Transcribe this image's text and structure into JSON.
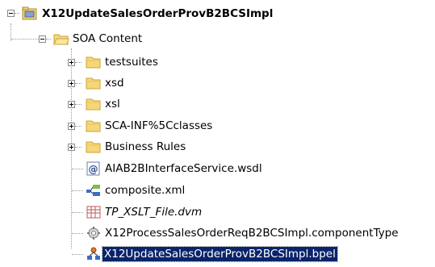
{
  "tree": {
    "root": {
      "label": "X12UpdateSalesOrderProvB2BCSImpl",
      "icon": "project-folder-icon",
      "expanded": true
    },
    "soa_content": {
      "label": "SOA Content",
      "icon": "folder-open-icon",
      "expanded": true
    },
    "items": [
      {
        "label": "testsuites",
        "icon": "folder-icon",
        "expandable": true
      },
      {
        "label": "xsd",
        "icon": "folder-icon",
        "expandable": true
      },
      {
        "label": "xsl",
        "icon": "folder-icon",
        "expandable": true
      },
      {
        "label": "SCA-INF%5Cclasses",
        "icon": "folder-icon",
        "expandable": true
      },
      {
        "label": "Business Rules",
        "icon": "folder-icon",
        "expandable": true
      },
      {
        "label": "AIAB2BInterfaceService.wsdl",
        "icon": "wsdl-file-icon",
        "expandable": false
      },
      {
        "label": "composite.xml",
        "icon": "composite-file-icon",
        "expandable": false
      },
      {
        "label": "TP_XSLT_File.dvm",
        "icon": "dvm-file-icon",
        "expandable": false
      },
      {
        "label": "X12ProcessSalesOrderReqB2BCSImpl.componentType",
        "icon": "component-type-icon",
        "expandable": false
      },
      {
        "label": "X12UpdateSalesOrderProvB2BCSImpl.bpel",
        "icon": "bpel-file-icon",
        "expandable": false,
        "selected": true
      }
    ]
  },
  "colors": {
    "folder_fill": "#f5d77a",
    "folder_edge": "#c9a43a",
    "selection_bg": "#0a246a",
    "selection_fg": "#ffffff",
    "tree_line": "#9a9a9a"
  }
}
